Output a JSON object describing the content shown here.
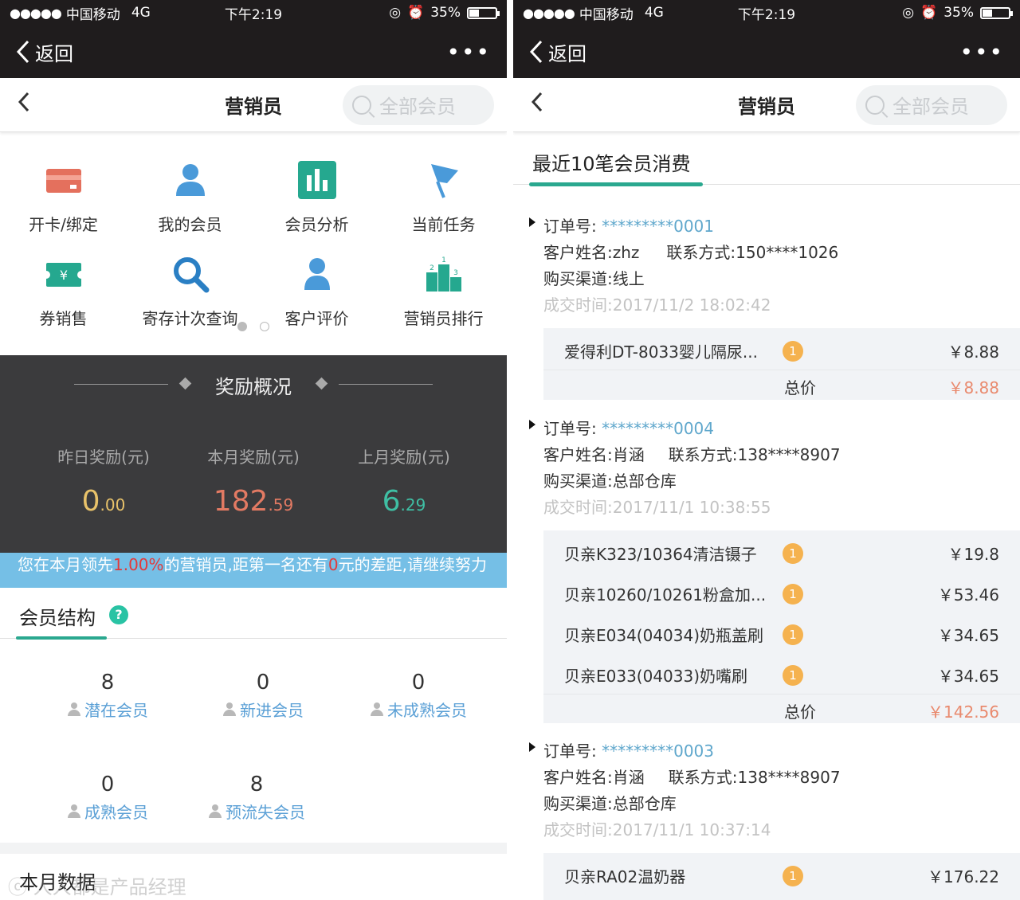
{
  "status": {
    "carrier": "中国移动",
    "network": "4G",
    "time": "下午2:19",
    "battery": "35%",
    "battery_level": 0.35
  },
  "wechat": {
    "back": "返回",
    "more": "•••"
  },
  "header": {
    "back_icon": "chevron-left",
    "title": "营销员",
    "search_placeholder": "全部会员"
  },
  "functions": [
    {
      "label": "开卡/绑定",
      "icon": "card-icon"
    },
    {
      "label": "我的会员",
      "icon": "user-icon"
    },
    {
      "label": "会员分析",
      "icon": "bar-chart-icon"
    },
    {
      "label": "当前任务",
      "icon": "flag-icon"
    },
    {
      "label": "券销售",
      "icon": "coupon-icon"
    },
    {
      "label": "寄存计次查询",
      "icon": "search-icon"
    },
    {
      "label": "客户评价",
      "icon": "customer-icon"
    },
    {
      "label": "营销员排行",
      "icon": "podium-icon"
    }
  ],
  "reward": {
    "title": "奖励概况",
    "yesterday": {
      "caption": "昨日奖励(元)",
      "int": "0",
      "dec": ".00",
      "color": "#e8c26a"
    },
    "month": {
      "caption": "本月奖励(元)",
      "int": "182",
      "dec": ".59",
      "color": "#e37a63"
    },
    "lastmonth": {
      "caption": "上月奖励(元)",
      "int": "6",
      "dec": ".29",
      "color": "#3fbfa4"
    }
  },
  "marquee": {
    "p1": "您在本月领先",
    "pct": "1.00%",
    "p2": "的营销员,距第一名还有",
    "gap": "0",
    "p3": "元的差距,请继续努力"
  },
  "member_structure": {
    "title": "会员结构",
    "help": "?",
    "groups": [
      {
        "count": "8",
        "label": "潜在会员"
      },
      {
        "count": "0",
        "label": "新进会员"
      },
      {
        "count": "0",
        "label": "未成熟会员"
      },
      {
        "count": "0",
        "label": "成熟会员"
      },
      {
        "count": "8",
        "label": "预流失会员"
      }
    ]
  },
  "month_data": {
    "title": "本月数据"
  },
  "orders_title": "最近10笔会员消费",
  "labels": {
    "order_no": "订单号:",
    "customer": "客户姓名:",
    "contact": "联系方式:",
    "channel": "购买渠道:",
    "time": "成交时间:",
    "total": "总价"
  },
  "orders": [
    {
      "no": "*********0001",
      "customer": "zhz",
      "contact": "150****1026",
      "channel": "线上",
      "time": "2017/11/2 18:02:42",
      "items": [
        {
          "name": "爱得利DT-8033婴儿隔尿...",
          "qty": "1",
          "price": "￥8.88"
        }
      ],
      "total": "￥8.88"
    },
    {
      "no": "*********0004",
      "customer": "肖涵",
      "contact": "138****8907",
      "channel": "总部仓库",
      "time": "2017/11/1 10:38:55",
      "items": [
        {
          "name": "贝亲K323/10364清洁镊子",
          "qty": "1",
          "price": "￥19.8"
        },
        {
          "name": "贝亲10260/10261粉盒加...",
          "qty": "1",
          "price": "￥53.46"
        },
        {
          "name": "贝亲E034(04034)奶瓶盖刷",
          "qty": "1",
          "price": "￥34.65"
        },
        {
          "name": "贝亲E033(04033)奶嘴刷",
          "qty": "1",
          "price": "￥34.65"
        }
      ],
      "total": "￥142.56"
    },
    {
      "no": "*********0003",
      "customer": "肖涵",
      "contact": "138****8907",
      "channel": "总部仓库",
      "time": "2017/11/1 10:37:14",
      "items": [
        {
          "name": "贝亲RA02温奶器",
          "qty": "1",
          "price": "￥176.22"
        }
      ],
      "total": ""
    }
  ],
  "watermark": "ⓒ 人人都是产品经理"
}
